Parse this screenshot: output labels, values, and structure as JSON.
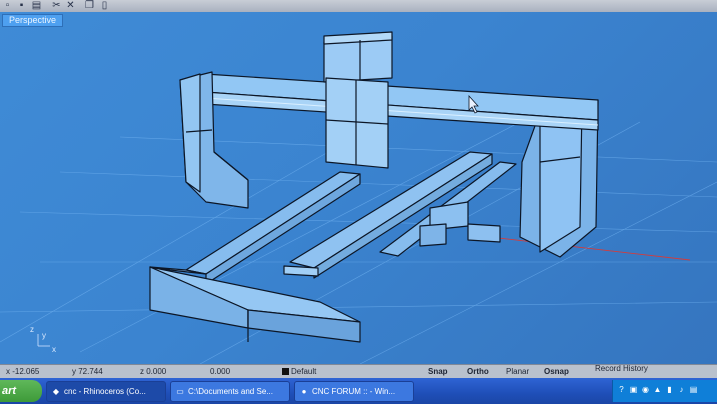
{
  "toolbar": {
    "icons": [
      "new-file-icon",
      "save-icon",
      "print-icon",
      "cut-icon",
      "close-icon",
      "copy-icon",
      "paste-icon"
    ],
    "glyphs": [
      "▫",
      "▪",
      "▤",
      "✂",
      "✕",
      "❐",
      "▯"
    ]
  },
  "viewport": {
    "label": "Perspective",
    "axis_y": "y",
    "axis_x": "x",
    "axis_z": "z"
  },
  "status": {
    "x": "x -12.065",
    "y": "y 72.744",
    "z": "z 0.000",
    "extra": "0.000",
    "layer": "Default",
    "snap": "Snap",
    "ortho": "Ortho",
    "planar": "Planar",
    "osnap": "Osnap",
    "record": "Record History"
  },
  "taskbar": {
    "start": "art",
    "tasks": [
      {
        "label": "cnc - Rhinoceros (Co...",
        "icon": "rhino-icon"
      },
      {
        "label": "C:\\Documents and Se...",
        "icon": "folder-icon"
      },
      {
        "label": "CNC FORUM :: - Win...",
        "icon": "browser-icon"
      }
    ]
  },
  "colors": {
    "viewport_bg": "#3b84d0",
    "model_fill": "#86bdf0",
    "model_edge": "#0c1626"
  }
}
